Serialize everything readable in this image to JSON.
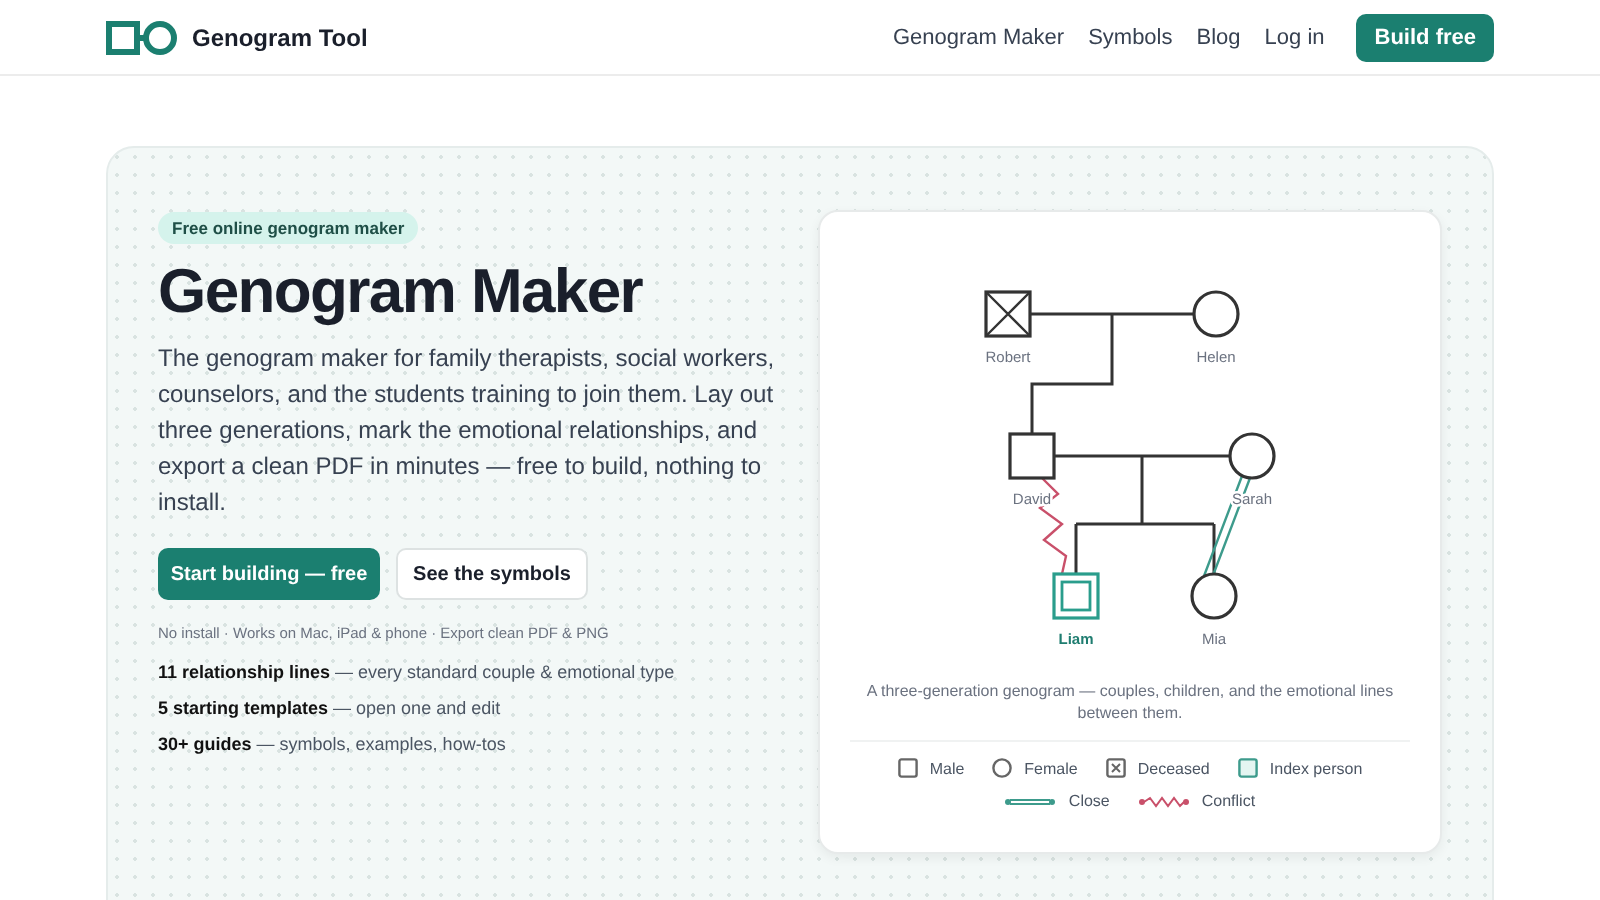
{
  "header": {
    "logo_text": "Genogram Tool",
    "nav": [
      "Genogram Maker",
      "Symbols",
      "Blog",
      "Log in"
    ],
    "cta": "Build free"
  },
  "hero": {
    "badge": "Free online genogram maker",
    "title": "Genogram Maker",
    "description": "The genogram maker for family therapists, social workers, counselors, and the students training to join them. Lay out three generations, mark the emotional relationships, and export a clean PDF in minutes — free to build, nothing to install.",
    "buttons": [
      {
        "label": "Start building — free",
        "kind": "primary"
      },
      {
        "label": "See the symbols",
        "kind": "secondary"
      }
    ],
    "note": "No install · Works on Mac, iPad & phone · Export clean PDF & PNG",
    "stats": [
      "**11 relationship lines** — every standard couple & emotional type",
      "**5 starting templates** — open one and edit",
      "**30+ guides** — symbols, examples, how-tos"
    ]
  },
  "diagram": {
    "people": [
      {
        "name": "Robert",
        "kind": "male",
        "deceased": true,
        "index": false
      },
      {
        "name": "Helen",
        "kind": "female",
        "deceased": false,
        "index": false
      },
      {
        "name": "David",
        "kind": "male",
        "deceased": false,
        "index": false
      },
      {
        "name": "Sarah",
        "kind": "female",
        "deceased": false,
        "index": false
      },
      {
        "name": "Liam",
        "kind": "male",
        "deceased": false,
        "index": true
      },
      {
        "name": "Mia",
        "kind": "female",
        "deceased": false,
        "index": false
      }
    ],
    "caption": "A three-generation genogram — couples, children, and the emotional lines between them.",
    "legend_symbols": [
      {
        "label": "Male",
        "kind": "male"
      },
      {
        "label": "Female",
        "kind": "female"
      },
      {
        "label": "Deceased",
        "kind": "deceased"
      },
      {
        "label": "Index person",
        "kind": "index"
      }
    ],
    "legend_lines": [
      {
        "label": "Close",
        "kind": "close"
      },
      {
        "label": "Conflict",
        "kind": "conflict"
      }
    ]
  }
}
